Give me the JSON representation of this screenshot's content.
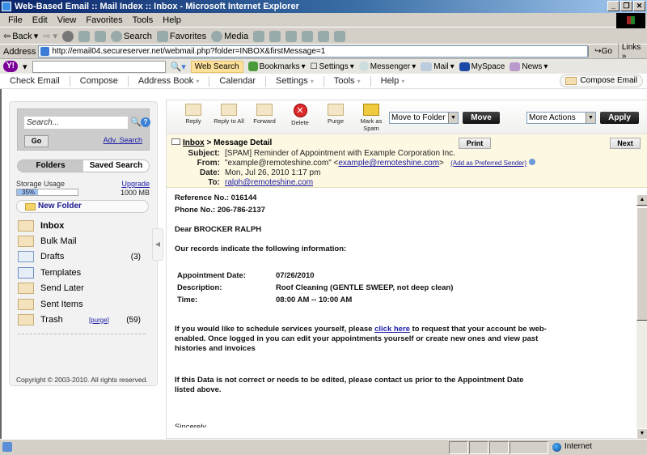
{
  "window": {
    "title": "Web-Based Email :: Mail Index :: Inbox - Microsoft Internet Explorer"
  },
  "menu": [
    "File",
    "Edit",
    "View",
    "Favorites",
    "Tools",
    "Help"
  ],
  "toolbar": {
    "back": "Back",
    "search": "Search",
    "favorites": "Favorites",
    "media": "Media"
  },
  "address": {
    "label": "Address",
    "url": "http://email04.secureserver.net/webmail.php?folder=INBOX&firstMessage=1",
    "go": "Go",
    "links": "Links"
  },
  "yahoo": {
    "logo": "Y!",
    "web_search": "Web Search",
    "bookmarks": "Bookmarks",
    "settings": "Settings",
    "messenger": "Messenger",
    "mail": "Mail",
    "myspace": "MySpace",
    "news": "News"
  },
  "nav": {
    "items": [
      "Check Email",
      "Compose",
      "Address Book",
      "Calendar",
      "Settings",
      "Tools",
      "Help"
    ],
    "compose_email": "Compose Email"
  },
  "sidebar": {
    "search_placeholder": "Search...",
    "go": "Go",
    "adv_search": "Adv. Search",
    "tabs": {
      "folders": "Folders",
      "saved_search": "Saved Search"
    },
    "storage_label": "Storage Usage",
    "upgrade": "Upgrade",
    "storage_percent": "35%",
    "storage_fraction": 0.35,
    "storage_size": "1000 MB",
    "new_folder": "New Folder",
    "folders": [
      {
        "name": "Inbox",
        "count": ""
      },
      {
        "name": "Bulk Mail",
        "count": ""
      },
      {
        "name": "Drafts",
        "count": "(3)"
      },
      {
        "name": "Templates",
        "count": ""
      },
      {
        "name": "Send Later",
        "count": ""
      },
      {
        "name": "Sent Items",
        "count": ""
      },
      {
        "name": "Trash",
        "count": "(59)",
        "purge": "[purge]"
      }
    ],
    "copyright": "Copyright © 2003-2010. All rights reserved."
  },
  "actions": {
    "reply": "Reply",
    "reply_all": "Reply to All",
    "forward": "Forward",
    "delete": "Delete",
    "purge": "Purge",
    "mark_spam_1": "Mark as",
    "mark_spam_2": "Spam",
    "move_select": "Move to Folder",
    "move_btn": "Move",
    "more_select": "More Actions",
    "apply_btn": "Apply"
  },
  "message": {
    "breadcrumb_link": "Inbox",
    "breadcrumb_rest": " > Message Detail",
    "print": "Print",
    "next": "Next",
    "labels": {
      "subject": "Subject:",
      "from": "From:",
      "date": "Date:",
      "to": "To:"
    },
    "subject": "[SPAM] Reminder of Appointment with Example Corporation Inc.",
    "from_name": "\"example@remoteshine.com\" <",
    "from_email": "example@remoteshine.com",
    "from_end": ">",
    "add_sender": "(Add as Preferred Sender)",
    "date": "Mon, Jul 26, 2010 1:17 pm",
    "to": "ralph@remoteshine.com"
  },
  "body": {
    "ref": "Reference No.:  016144",
    "phone": "Phone No.:  206-786-2137",
    "dear": "Dear  BROCKER RALPH",
    "records": "Our records indicate the following information:",
    "appt_label": "Appointment Date:",
    "appt_value": "07/26/2010",
    "desc_label": "Description:",
    "desc_value": "Roof Cleaning (GENTLE SWEEP, not deep clean)",
    "time_label": "Time:",
    "time_value": "08:00 AM -- 10:00 AM",
    "p1_a": "If you would like to schedule services yourself, please ",
    "p1_link": "click here",
    "p1_b": " to request that your account be web-",
    "p1_line2": "enabled. Once logged in you can edit your appointments yourself or create new ones and view past",
    "p1_line3": "histories and invoices",
    "p2_line1": "If this Data is not correct or needs to be edited, please contact us prior to the Appointment Date",
    "p2_line2": "listed above.",
    "closing": "Sincerely"
  },
  "status": {
    "zone": "Internet"
  }
}
